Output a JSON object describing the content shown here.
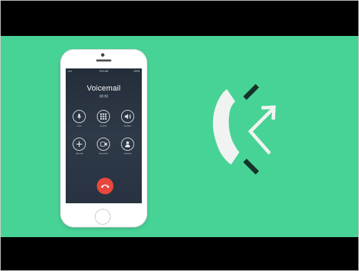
{
  "call_screen": {
    "status": {
      "carrier": "••••• ",
      "time": "9:41 AM",
      "battery": "100%"
    },
    "caller_name": "Voicemail",
    "timer": "00:30",
    "controls": [
      {
        "label": "mute",
        "icon": "microphone-icon"
      },
      {
        "label": "keypad",
        "icon": "keypad-icon"
      },
      {
        "label": "speaker",
        "icon": "speaker-icon"
      },
      {
        "label": "add call",
        "icon": "plus-icon"
      },
      {
        "label": "FaceTime",
        "icon": "video-camera-icon"
      },
      {
        "label": "contacts",
        "icon": "contact-person-icon"
      }
    ],
    "end_call_icon": "hang-up-phone-icon"
  },
  "graphic": {
    "icon": "call-transfer-icon"
  },
  "colors": {
    "background": "#48d396",
    "phone_screen": "#2a3442",
    "end_call": "#e8473d",
    "bars": "#000000"
  }
}
